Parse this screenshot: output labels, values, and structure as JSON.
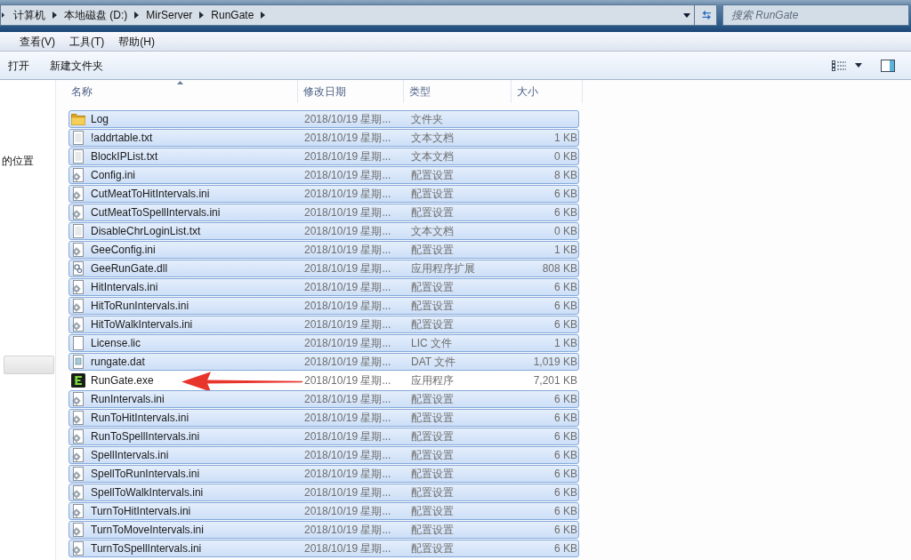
{
  "address_bar": {
    "breadcrumbs": [
      "计算机",
      "本地磁盘 (D:)",
      "MirServer",
      "RunGate"
    ]
  },
  "search": {
    "placeholder": "搜索 RunGate"
  },
  "menu_bar": [
    "查看(V)",
    "工具(T)",
    "帮助(H)"
  ],
  "toolbar": [
    "打开",
    "新建文件夹"
  ],
  "sidebar": {
    "items": [
      {
        "label": "的位置",
        "selected": false
      },
      {
        "selected": true
      }
    ]
  },
  "table": {
    "columns": [
      {
        "label": "名称",
        "sorted": true
      },
      {
        "label": "修改日期",
        "sorted": false
      },
      {
        "label": "类型",
        "sorted": false
      },
      {
        "label": "大小",
        "sorted": false
      }
    ],
    "rows": [
      {
        "kind": "folder",
        "name": "Log",
        "modified": "2018/10/19 星期...",
        "type": "文件夹",
        "selected": true,
        "marked": false
      },
      {
        "kind": "text",
        "name": "!addrtable.txt",
        "modified": "2018/10/19 星期...",
        "type": "文本文档",
        "size": "1 KB",
        "selected": true,
        "marked": false
      },
      {
        "kind": "text",
        "name": "BlockIPList.txt",
        "modified": "2018/10/19 星期...",
        "type": "文本文档",
        "size": "0 KB",
        "selected": true,
        "marked": false
      },
      {
        "kind": "config",
        "name": "Config.ini",
        "modified": "2018/10/19 星期...",
        "type": "配置设置",
        "size": "8 KB",
        "selected": true,
        "marked": false
      },
      {
        "kind": "config",
        "name": "CutMeatToHitIntervals.ini",
        "modified": "2018/10/19 星期...",
        "type": "配置设置",
        "size": "6 KB",
        "selected": true,
        "marked": false
      },
      {
        "kind": "config",
        "name": "CutMeatToSpellIntervals.ini",
        "modified": "2018/10/19 星期...",
        "type": "配置设置",
        "size": "6 KB",
        "selected": true,
        "marked": false
      },
      {
        "kind": "text",
        "name": "DisableChrLoginList.txt",
        "modified": "2018/10/19 星期...",
        "type": "文本文档",
        "size": "0 KB",
        "selected": true,
        "marked": false
      },
      {
        "kind": "config",
        "name": "GeeConfig.ini",
        "modified": "2018/10/19 星期...",
        "type": "配置设置",
        "size": "1 KB",
        "selected": true,
        "marked": false
      },
      {
        "kind": "dll",
        "name": "GeeRunGate.dll",
        "modified": "2018/10/19 星期...",
        "type": "应用程序扩展",
        "size": "808 KB",
        "selected": true,
        "marked": false
      },
      {
        "kind": "config",
        "name": "HitIntervals.ini",
        "modified": "2018/10/19 星期...",
        "type": "配置设置",
        "size": "6 KB",
        "selected": true,
        "marked": false
      },
      {
        "kind": "config",
        "name": "HitToRunIntervals.ini",
        "modified": "2018/10/19 星期...",
        "type": "配置设置",
        "size": "6 KB",
        "selected": true,
        "marked": false
      },
      {
        "kind": "config",
        "name": "HitToWalkIntervals.ini",
        "modified": "2018/10/19 星期...",
        "type": "配置设置",
        "size": "6 KB",
        "selected": true,
        "marked": false
      },
      {
        "kind": "blank",
        "name": "License.lic",
        "modified": "2018/10/19 星期...",
        "type": "LIC 文件",
        "size": "1 KB",
        "selected": true,
        "marked": false
      },
      {
        "kind": "dat",
        "name": "rungate.dat",
        "modified": "2018/10/19 星期...",
        "type": "DAT 文件",
        "size": "1,019 KB",
        "selected": true,
        "marked": false
      },
      {
        "kind": "exe",
        "name": "RunGate.exe",
        "modified": "2018/10/19 星期...",
        "type": "应用程序",
        "size": "7,201 KB",
        "selected": false,
        "marked": true
      },
      {
        "kind": "config",
        "name": "RunIntervals.ini",
        "modified": "2018/10/19 星期...",
        "type": "配置设置",
        "size": "6 KB",
        "selected": true,
        "marked": false
      },
      {
        "kind": "config",
        "name": "RunToHitIntervals.ini",
        "modified": "2018/10/19 星期...",
        "type": "配置设置",
        "size": "6 KB",
        "selected": true,
        "marked": false
      },
      {
        "kind": "config",
        "name": "RunToSpellIntervals.ini",
        "modified": "2018/10/19 星期...",
        "type": "配置设置",
        "size": "6 KB",
        "selected": true,
        "marked": false
      },
      {
        "kind": "config",
        "name": "SpellIntervals.ini",
        "modified": "2018/10/19 星期...",
        "type": "配置设置",
        "size": "6 KB",
        "selected": true,
        "marked": false
      },
      {
        "kind": "config",
        "name": "SpellToRunIntervals.ini",
        "modified": "2018/10/19 星期...",
        "type": "配置设置",
        "size": "6 KB",
        "selected": true,
        "marked": false
      },
      {
        "kind": "config",
        "name": "SpellToWalkIntervals.ini",
        "modified": "2018/10/19 星期...",
        "type": "配置设置",
        "size": "6 KB",
        "selected": true,
        "marked": false
      },
      {
        "kind": "config",
        "name": "TurnToHitIntervals.ini",
        "modified": "2018/10/19 星期...",
        "type": "配置设置",
        "size": "6 KB",
        "selected": true,
        "marked": false
      },
      {
        "kind": "config",
        "name": "TurnToMoveIntervals.ini",
        "modified": "2018/10/19 星期...",
        "type": "配置设置",
        "size": "6 KB",
        "selected": true,
        "marked": false
      },
      {
        "kind": "config",
        "name": "TurnToSpellIntervals.ini",
        "modified": "2018/10/19 星期...",
        "type": "配置设置",
        "size": "6 KB",
        "selected": true,
        "marked": false
      }
    ]
  }
}
